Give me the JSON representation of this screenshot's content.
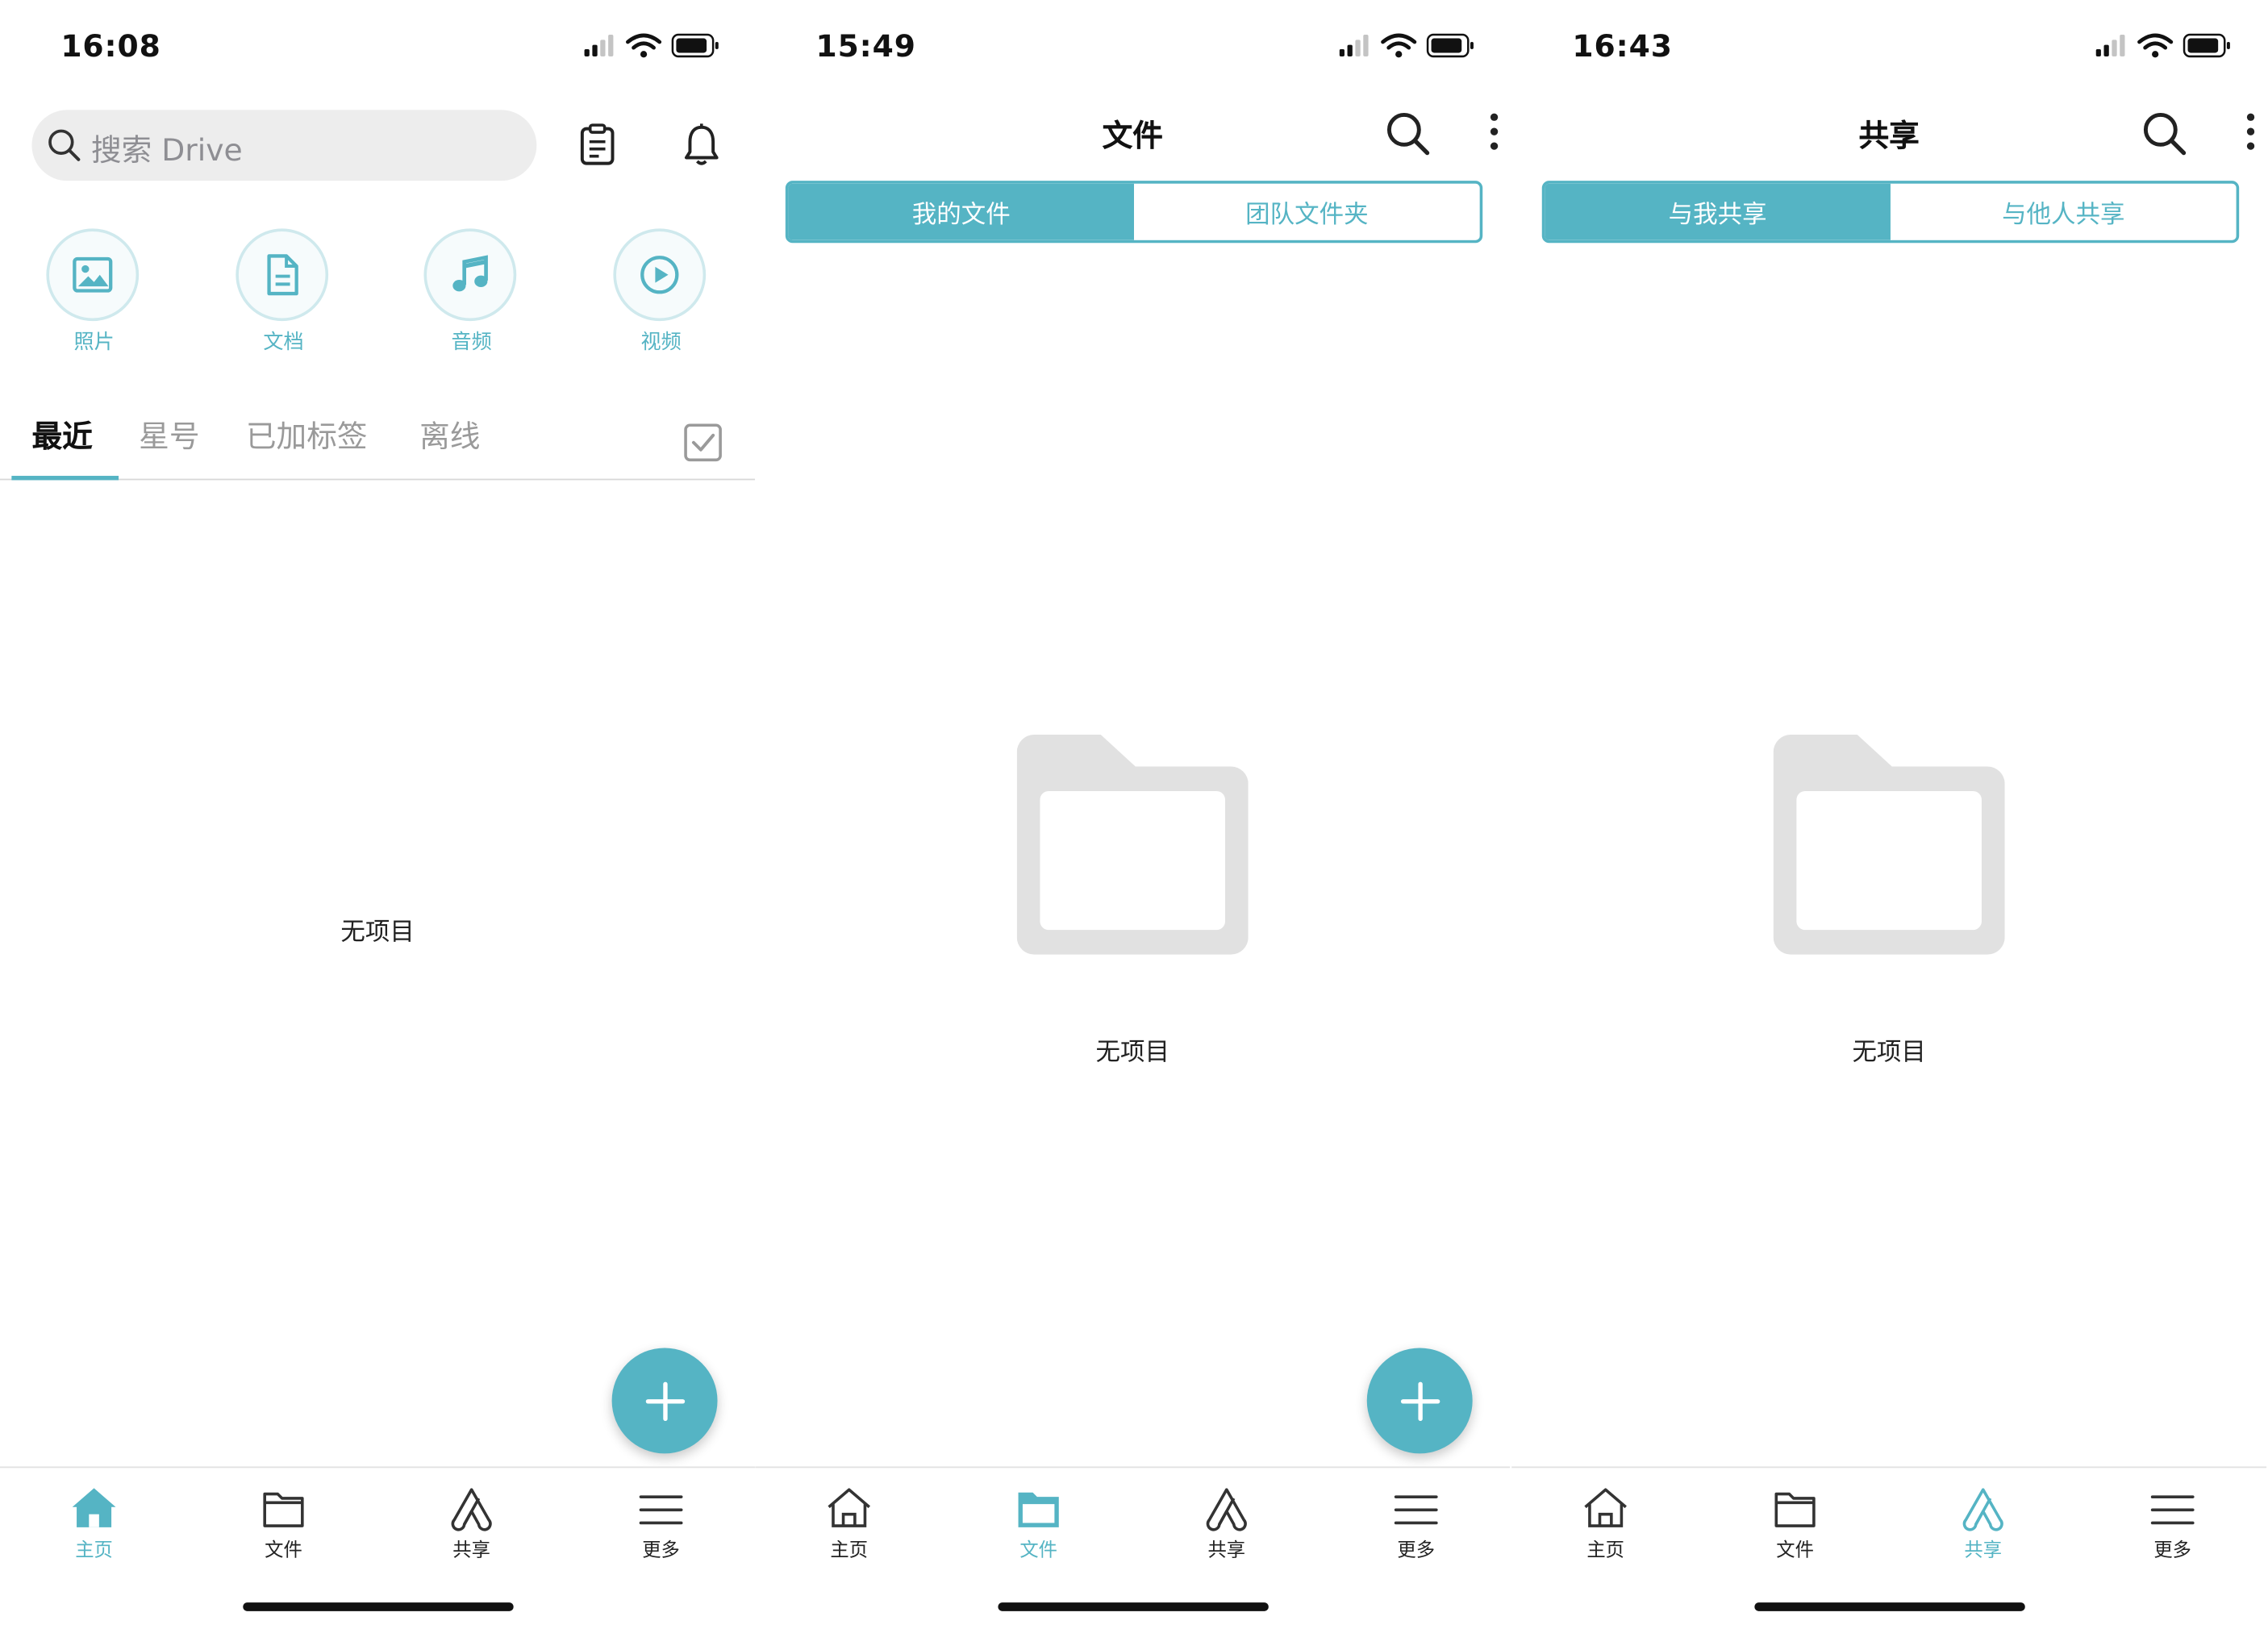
{
  "accent_color": "#55b4c4",
  "screens": [
    {
      "status_time": "16:08",
      "search_placeholder": "搜索 Drive",
      "categories": [
        {
          "label": "照片",
          "icon": "photo-icon"
        },
        {
          "label": "文档",
          "icon": "document-icon"
        },
        {
          "label": "音频",
          "icon": "music-icon"
        },
        {
          "label": "视频",
          "icon": "video-play-icon"
        }
      ],
      "tabs": [
        "最近",
        "星号",
        "已加标签",
        "离线"
      ],
      "active_tab": "最近",
      "empty_text": "无项目",
      "fab_icon": "plus-icon"
    },
    {
      "status_time": "15:49",
      "title": "文件",
      "segments": [
        "我的文件",
        "团队文件夹"
      ],
      "active_segment": "我的文件",
      "empty_text": "无项目",
      "fab_icon": "plus-icon"
    },
    {
      "status_time": "16:43",
      "title": "共享",
      "segments": [
        "与我共享",
        "与他人共享"
      ],
      "active_segment": "与我共享",
      "empty_text": "无项目"
    }
  ],
  "bottom_nav": [
    {
      "label": "主页",
      "icon": "home-icon"
    },
    {
      "label": "文件",
      "icon": "folder-icon"
    },
    {
      "label": "共享",
      "icon": "share-icon"
    },
    {
      "label": "更多",
      "icon": "menu-icon"
    }
  ],
  "bottom_nav_active": [
    "主页",
    "文件",
    "共享"
  ]
}
